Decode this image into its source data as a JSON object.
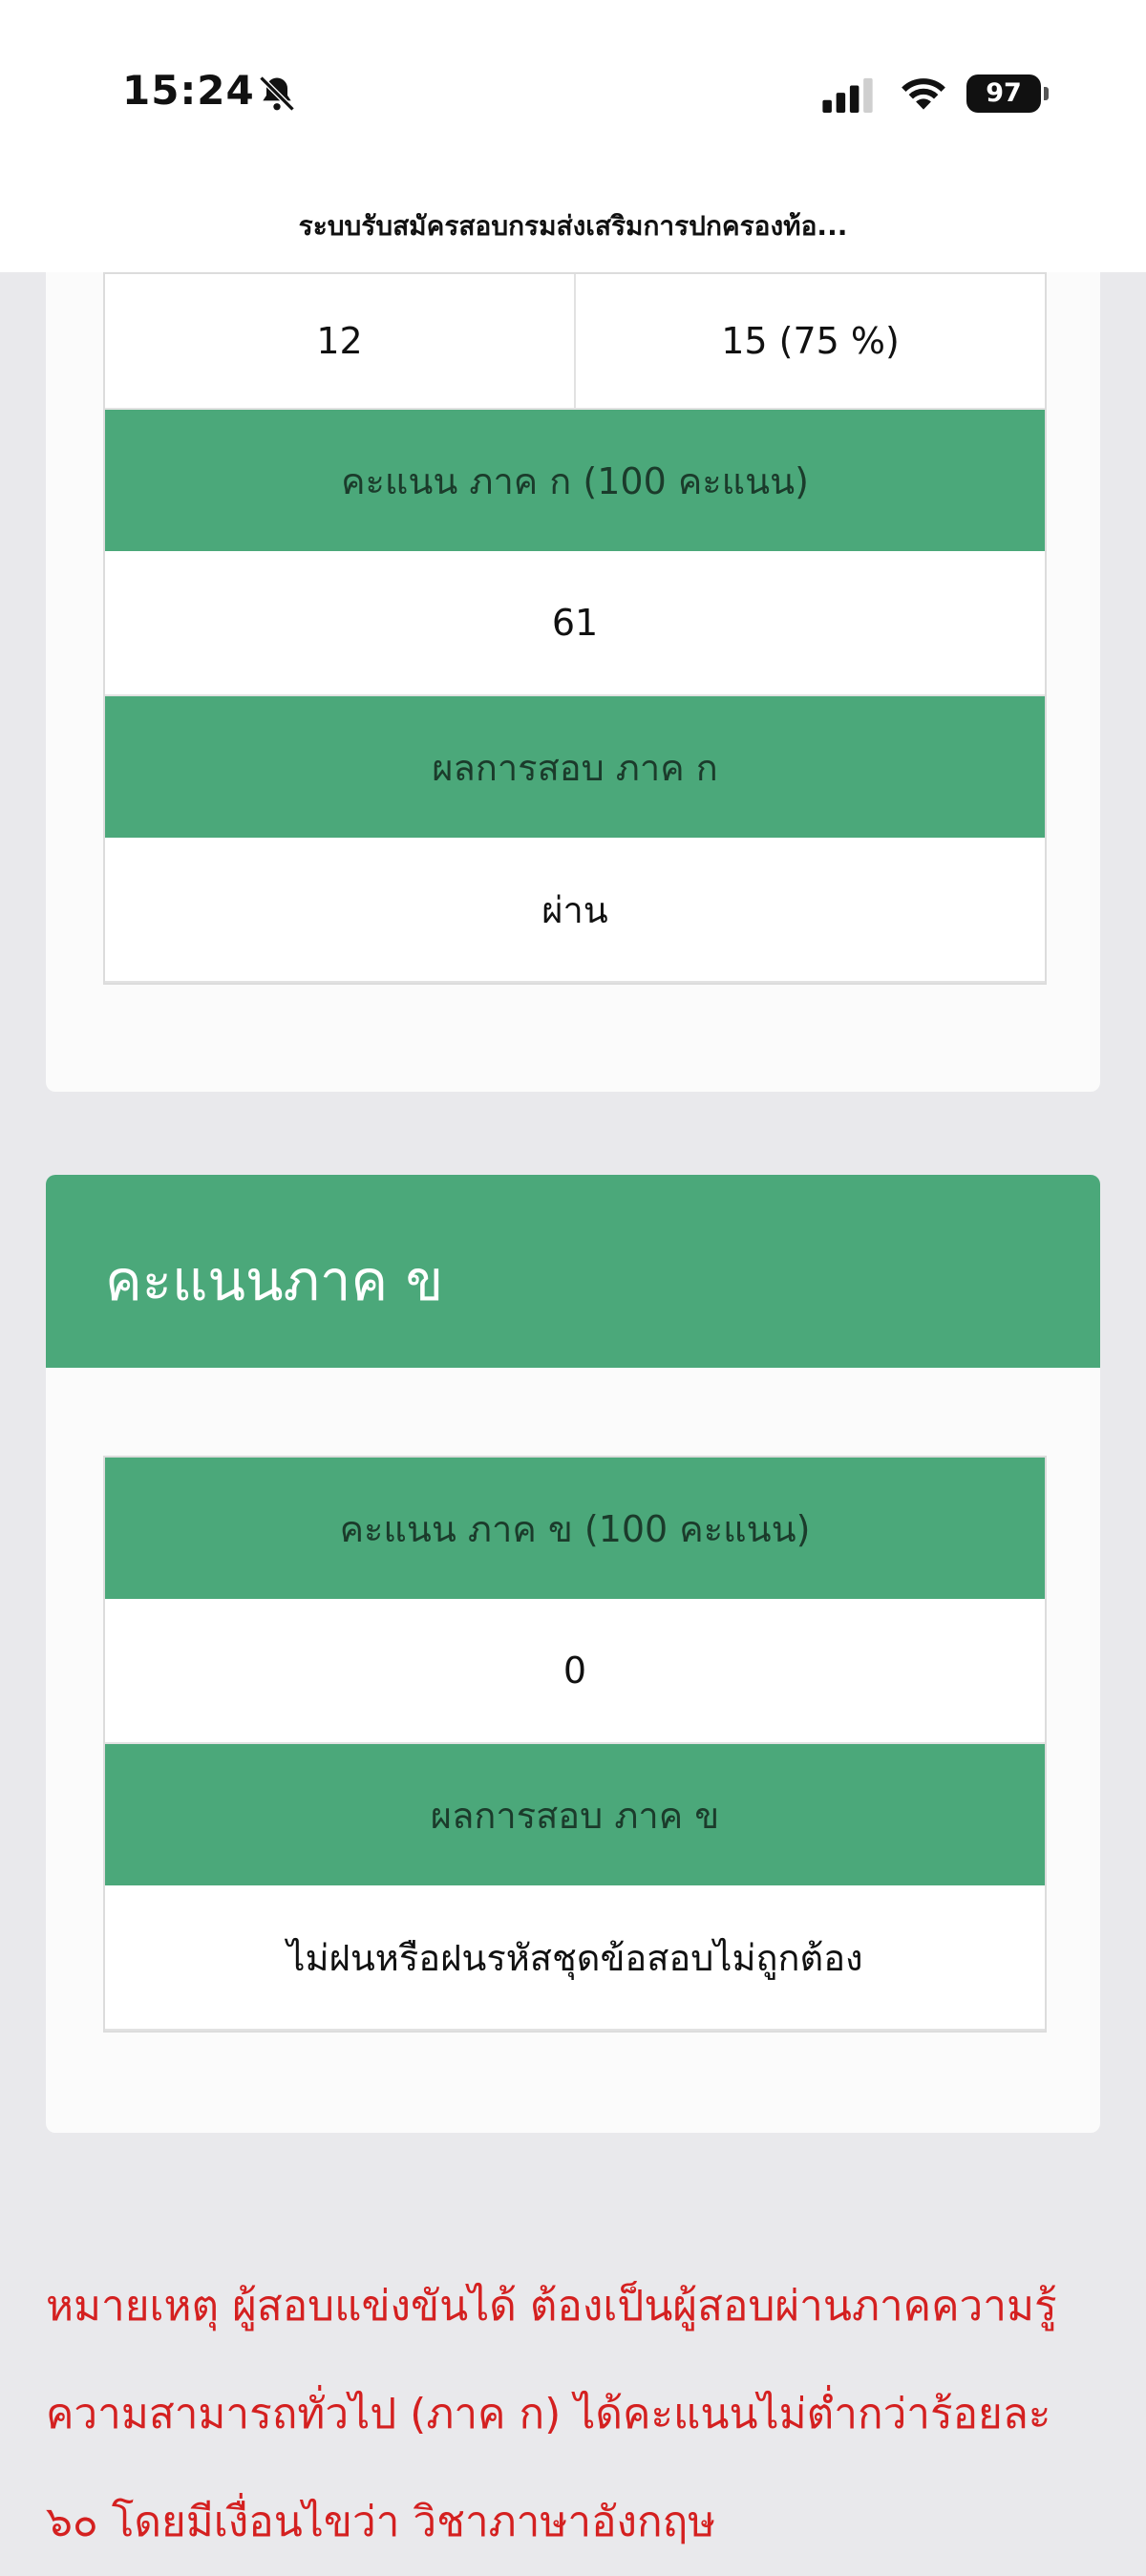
{
  "status_bar": {
    "time": "15:24",
    "battery": "97",
    "icons": [
      "bell-slash-icon",
      "cellular-signal-icon",
      "wifi-icon",
      "battery-icon"
    ]
  },
  "page": {
    "title": "ระบบรับสมัครสอบกรมส่งเสริมการปกครองท้อ..."
  },
  "part_a": {
    "row_split": [
      "12",
      "15 (75 %)"
    ],
    "score_header": "คะแนน ภาค ก (100 คะแนน)",
    "score_value": "61",
    "result_header": "ผลการสอบ ภาค ก",
    "result_value": "ผ่าน"
  },
  "part_b": {
    "title": "คะแนนภาค ข",
    "score_header": "คะแนน ภาค ข (100 คะแนน)",
    "score_value": "0",
    "result_header": "ผลการสอบ ภาค ข",
    "result_value": "ไม่ฝนหรือฝนรหัสชุดข้อสอบไม่ถูกต้อง"
  },
  "note": {
    "text": "หมายเหตุ ผู้สอบแข่งขันได้ ต้องเป็นผู้สอบผ่านภาคความรู้ความสามารถทั่วไป (ภาค ก) ได้คะแนนไม่ต่ำกว่าร้อยละ ๖๐ โดยมีเงื่อนไขว่า วิชาภาษาอังกฤษ"
  },
  "colors": {
    "accent_green": "#4ba87a",
    "note_red": "#d42020",
    "background": "#e9e9ec"
  }
}
